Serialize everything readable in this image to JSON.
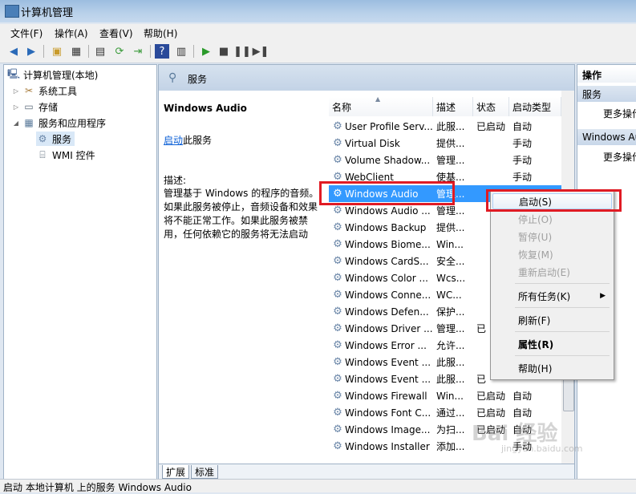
{
  "window": {
    "title": "计算机管理"
  },
  "menu": [
    "文件(F)",
    "操作(A)",
    "查看(V)",
    "帮助(H)"
  ],
  "tree": {
    "root": "计算机管理(本地)",
    "items": [
      {
        "label": "系统工具"
      },
      {
        "label": "存储"
      },
      {
        "label": "服务和应用程序"
      },
      {
        "label": "服务"
      },
      {
        "label": "WMI 控件"
      }
    ]
  },
  "center": {
    "header": "服务",
    "selected_name": "Windows Audio",
    "start_link": "启动",
    "start_suffix": "此服务",
    "desc_label": "描述:",
    "desc_text": "管理基于 Windows 的程序的音频。如果此服务被停止，音频设备和效果将不能正常工作。如果此服务被禁用，任何依赖它的服务将无法启动",
    "columns": [
      "名称",
      "描述",
      "状态",
      "启动类型"
    ],
    "rows": [
      [
        "User Profile Serv...",
        "此服...",
        "已启动",
        "自动"
      ],
      [
        "Virtual Disk",
        "提供...",
        "",
        "手动"
      ],
      [
        "Volume Shadow...",
        "管理...",
        "",
        "手动"
      ],
      [
        "WebClient",
        "使基...",
        "",
        "手动"
      ],
      [
        "Windows Audio",
        "管理...",
        "",
        ""
      ],
      [
        "Windows Audio ...",
        "管理...",
        "",
        ""
      ],
      [
        "Windows Backup",
        "提供...",
        "",
        ""
      ],
      [
        "Windows Biome...",
        "Win...",
        "",
        ""
      ],
      [
        "Windows CardS...",
        "安全...",
        "",
        ""
      ],
      [
        "Windows Color ...",
        "Wcs...",
        "",
        ""
      ],
      [
        "Windows Conne...",
        "WC...",
        "",
        ""
      ],
      [
        "Windows Defen...",
        "保护...",
        "",
        ""
      ],
      [
        "Windows Driver ...",
        "管理...",
        "已",
        ""
      ],
      [
        "Windows Error ...",
        "允许...",
        "",
        ""
      ],
      [
        "Windows Event ...",
        "此服...",
        "",
        ""
      ],
      [
        "Windows Event ...",
        "此服...",
        "已",
        ""
      ],
      [
        "Windows Firewall",
        "Win...",
        "已启动",
        "自动"
      ],
      [
        "Windows Font C...",
        "通过...",
        "已启动",
        "自动"
      ],
      [
        "Windows Image...",
        "为扫...",
        "已启动",
        "自动"
      ],
      [
        "Windows Installer",
        "添加...",
        "",
        "手动"
      ]
    ],
    "tabs": [
      "扩展",
      "标准"
    ]
  },
  "actions": {
    "title": "操作",
    "section1": "服务",
    "more1": "更多操作",
    "section2": "Windows Audio",
    "more2": "更多操作"
  },
  "context_menu": {
    "items": [
      {
        "label": "启动(S)",
        "disabled": false
      },
      {
        "label": "停止(O)",
        "disabled": true
      },
      {
        "label": "暂停(U)",
        "disabled": true
      },
      {
        "label": "恢复(M)",
        "disabled": true
      },
      {
        "label": "重新启动(E)",
        "disabled": true
      },
      {
        "label": "所有任务(K)",
        "disabled": false
      },
      {
        "label": "刷新(F)",
        "disabled": false
      },
      {
        "label": "属性(R)",
        "disabled": false
      },
      {
        "label": "帮助(H)",
        "disabled": false
      }
    ]
  },
  "status": "启动 本地计算机 上的服务 Windows Audio",
  "watermark": {
    "brand": "Bai 经验",
    "url": "jingyan.baidu.com"
  },
  "colors": {
    "selection": "#3399ff",
    "highlight_box": "#e01b24"
  }
}
